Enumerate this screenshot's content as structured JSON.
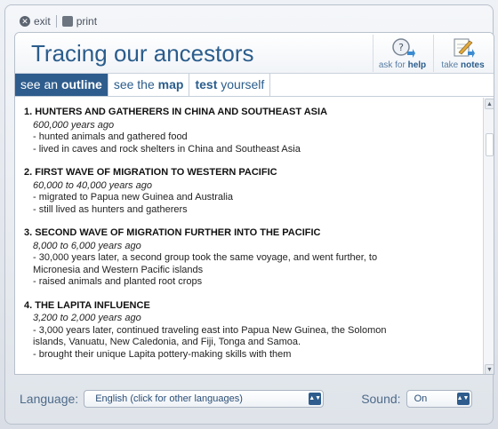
{
  "topbar": {
    "exit_label": "exit",
    "print_label": "print"
  },
  "header": {
    "title": "Tracing our ancestors",
    "help_prefix": "ask for ",
    "help_bold": "help",
    "notes_prefix": "take ",
    "notes_bold": "notes"
  },
  "tabs": [
    {
      "prefix": "see an ",
      "bold": "outline",
      "suffix": "",
      "active": true
    },
    {
      "prefix": "see the ",
      "bold": "map",
      "suffix": "",
      "active": false
    },
    {
      "prefix": "",
      "bold": "test",
      "suffix": " yourself",
      "active": false
    }
  ],
  "sections": [
    {
      "title": "1. HUNTERS AND GATHERERS IN CHINA AND SOUTHEAST ASIA",
      "date": "600,000 years ago",
      "lines": [
        "- hunted animals and gathered food",
        "- lived in caves and rock shelters in China and Southeast Asia"
      ]
    },
    {
      "title": "2. FIRST WAVE OF MIGRATION TO WESTERN PACIFIC",
      "date": "60,000 to 40,000 years ago",
      "lines": [
        "- migrated to Papua new Guinea and Australia",
        "- still lived as hunters and gatherers"
      ]
    },
    {
      "title": "3. SECOND WAVE OF MIGRATION FURTHER INTO THE PACIFIC",
      "date": "8,000 to 6,000 years ago",
      "lines": [
        "- 30,000 years later, a second group took the same voyage, and went further, to",
        "Micronesia and  Western Pacific islands",
        "- raised animals and planted root crops"
      ]
    },
    {
      "title": "4. THE LAPITA INFLUENCE",
      "date": "3,200 to 2,000 years ago",
      "lines": [
        "- 3,000 years later, continued traveling east into Papua New Guinea, the Solomon",
        "islands, Vanuatu, New Caledonia, and Fiji, Tonga and Samoa.",
        "- brought their unique Lapita pottery-making skills with them"
      ]
    }
  ],
  "footer": {
    "language_label": "Language:",
    "language_value": "English (click for other languages)",
    "sound_label": "Sound:",
    "sound_value": "On"
  }
}
